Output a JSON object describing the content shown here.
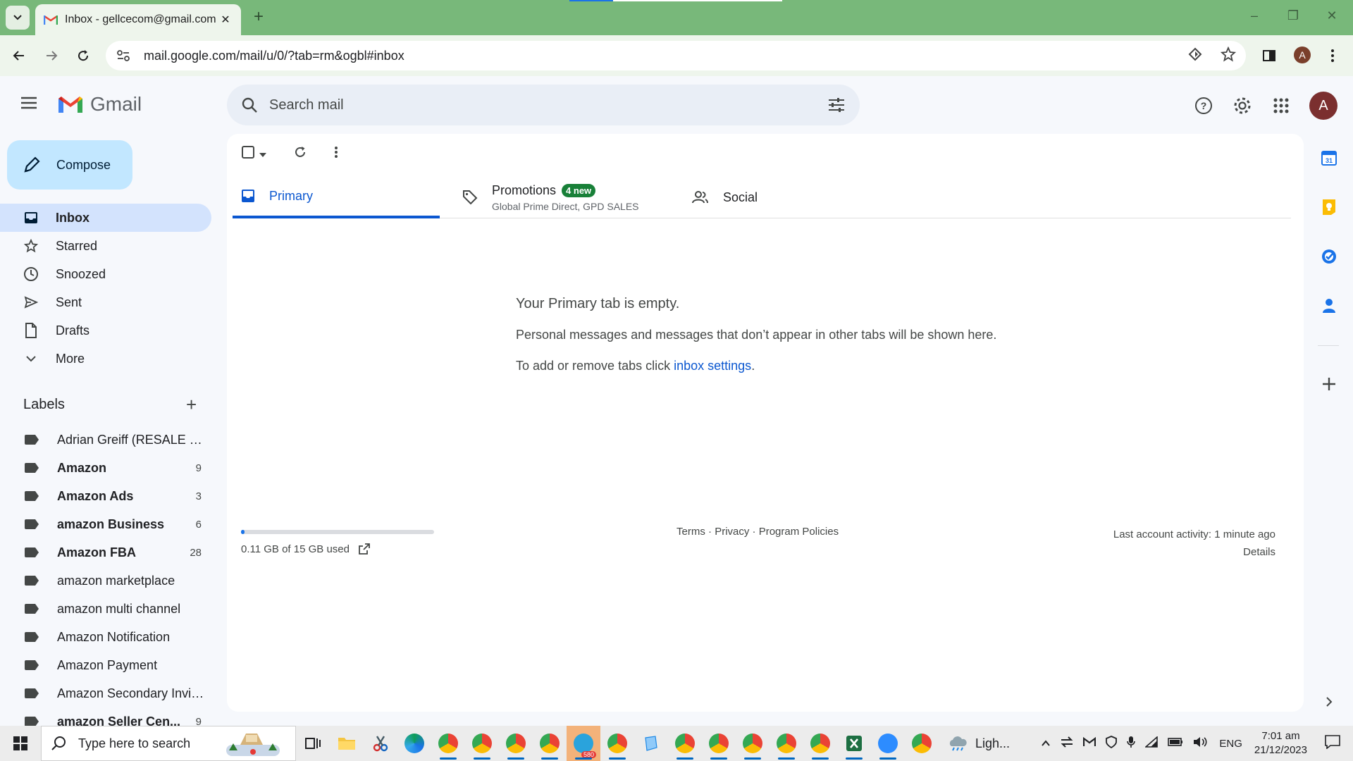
{
  "browser": {
    "tab_title": "Inbox - gellcecom@gmail.com",
    "url": "mail.google.com/mail/u/0/?tab=rm&ogbl#inbox",
    "profile_initial": "A"
  },
  "gmail": {
    "logo_text": "Gmail",
    "search_placeholder": "Search mail",
    "avatar_initial": "A",
    "compose_label": "Compose",
    "nav": [
      {
        "label": "Inbox",
        "icon": "inbox-icon",
        "active": true
      },
      {
        "label": "Starred",
        "icon": "star-icon"
      },
      {
        "label": "Snoozed",
        "icon": "clock-icon"
      },
      {
        "label": "Sent",
        "icon": "send-icon"
      },
      {
        "label": "Drafts",
        "icon": "draft-icon"
      },
      {
        "label": "More",
        "icon": "chevron-down-icon"
      }
    ],
    "labels_title": "Labels",
    "labels": [
      {
        "name": "Adrian Greiff (RESALE C...",
        "count": "",
        "bold": false
      },
      {
        "name": "Amazon",
        "count": "9",
        "bold": true
      },
      {
        "name": "Amazon Ads",
        "count": "3",
        "bold": true
      },
      {
        "name": "amazon Business",
        "count": "6",
        "bold": true
      },
      {
        "name": "Amazon FBA",
        "count": "28",
        "bold": true
      },
      {
        "name": "amazon marketplace",
        "count": "",
        "bold": false
      },
      {
        "name": "amazon multi channel",
        "count": "",
        "bold": false
      },
      {
        "name": "Amazon Notification",
        "count": "",
        "bold": false
      },
      {
        "name": "Amazon Payment",
        "count": "",
        "bold": false
      },
      {
        "name": "Amazon Secondary Invit...",
        "count": "",
        "bold": false
      },
      {
        "name": "amazon Seller Cen...",
        "count": "9",
        "bold": true
      }
    ],
    "tabs": {
      "primary": "Primary",
      "promotions": "Promotions",
      "promotions_badge": "4 new",
      "promotions_sub": "Global Prime Direct, GPD SALES",
      "social": "Social"
    },
    "empty": {
      "title": "Your Primary tab is empty.",
      "line1": "Personal messages and messages that don’t appear in other tabs will be shown here.",
      "line2_prefix": "To add or remove tabs click ",
      "line2_link": "inbox settings",
      "line2_suffix": "."
    },
    "storage_text": "0.11 GB of 15 GB used",
    "storage_fraction": 0.007,
    "footer": {
      "terms": "Terms",
      "privacy": "Privacy",
      "policies": "Program Policies",
      "sep": " · "
    },
    "activity": {
      "last": "Last account activity: 1 minute ago",
      "details": "Details"
    }
  },
  "taskbar": {
    "search_placeholder": "Type here to search",
    "weather_text": "Ligh...",
    "telegram_badge": "580",
    "lang": "ENG",
    "time": "7:01 am",
    "date": "21/12/2023"
  },
  "colors": {
    "accent": "#0b57d0",
    "compose_bg": "#c2e7ff",
    "active_nav": "#d3e3fd",
    "badge_green": "#188038",
    "chrome_frame": "#78b87a"
  }
}
